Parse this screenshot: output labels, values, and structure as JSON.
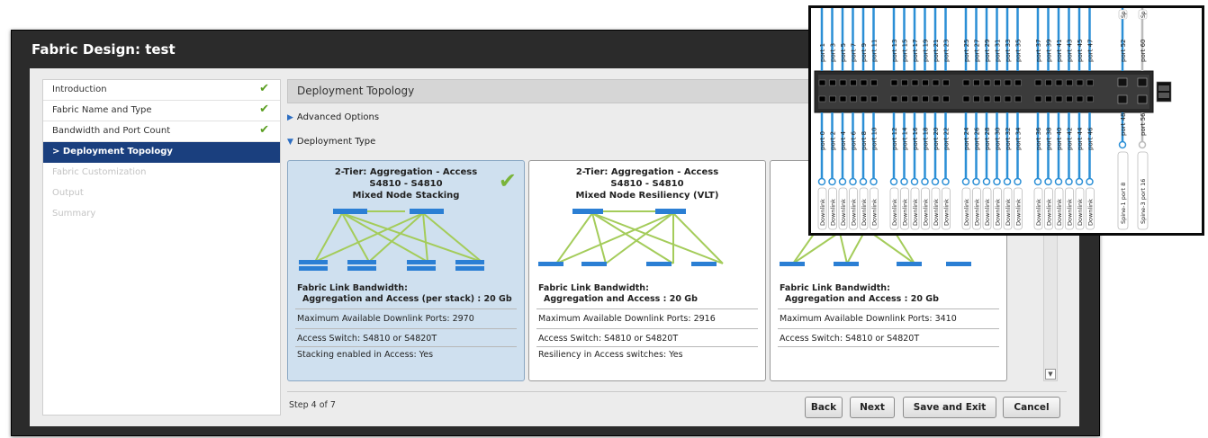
{
  "window": {
    "title": "Fabric Design: test"
  },
  "sidebar": {
    "items": [
      {
        "label": "Introduction",
        "completed": true
      },
      {
        "label": "Fabric Name and Type",
        "completed": true
      },
      {
        "label": "Bandwidth and Port Count",
        "completed": true
      },
      {
        "label": "> Deployment Topology",
        "active": true
      },
      {
        "label": "Fabric Customization",
        "disabled": true
      },
      {
        "label": "Output",
        "disabled": true
      },
      {
        "label": "Summary",
        "disabled": true
      }
    ]
  },
  "main": {
    "section_title": "Deployment Topology",
    "advanced_options": "Advanced Options",
    "deployment_type": "Deployment Type",
    "cards": [
      {
        "title1": "2-Tier: Aggregation - Access",
        "title2": "S4810 - S4810",
        "title3": "Mixed Node Stacking",
        "bw_label": "Fabric Link Bandwidth:",
        "bw_value": "Aggregation and Access (per stack) : 20 Gb",
        "ports": "Maximum Available Downlink Ports:  2970",
        "access": "Access Switch:  S4810 or S4820T",
        "extra": "Stacking enabled in Access:  Yes",
        "selected": true
      },
      {
        "title1": "2-Tier: Aggregation - Access",
        "title2": "S4810 - S4810",
        "title3": "Mixed Node Resiliency (VLT)",
        "bw_label": "Fabric Link Bandwidth:",
        "bw_value": "Aggregation and Access : 20 Gb",
        "ports": "Maximum Available Downlink Ports:  2916",
        "access": "Access Switch:  S4810 or S4820T",
        "extra": "Resiliency in Access switches:  Yes",
        "selected": false
      },
      {
        "title1": "",
        "title2": "",
        "title3": "",
        "bw_label": "Fabric Link Bandwidth:",
        "bw_value": "Aggregation and Access : 20 Gb",
        "ports": "Maximum Available Downlink Ports:  3410",
        "access": "Access Switch:  S4810 or S4820T",
        "extra": "",
        "selected": false
      }
    ],
    "step": "Step 4 of 7",
    "buttons": {
      "back": "Back",
      "next": "Next",
      "save_exit": "Save and Exit",
      "cancel": "Cancel"
    }
  },
  "overlay": {
    "top_ports": [
      "port 1",
      "port 3",
      "port 5",
      "port 7",
      "port 9",
      "port 11",
      "port 13",
      "port 15",
      "port 17",
      "port 19",
      "port 21",
      "port 23",
      "port 25",
      "port 27",
      "port 29",
      "port 31",
      "port 33",
      "port 35",
      "port 37",
      "port 39",
      "port 41",
      "port 43",
      "port 45",
      "port 47"
    ],
    "bottom_ports": [
      "port 0",
      "port 2",
      "port 4",
      "port 6",
      "port 8",
      "port 10",
      "port 12",
      "port 14",
      "port 16",
      "port 18",
      "port 20",
      "port 22",
      "port 24",
      "port 26",
      "port 28",
      "port 30",
      "port 32",
      "port 34",
      "port 36",
      "port 38",
      "port 40",
      "port 42",
      "port 44",
      "port 46"
    ],
    "uplink_top": [
      "port 52",
      "port 60"
    ],
    "uplink_bottom": [
      "port 48",
      "port 56"
    ],
    "downlink_label": "Downlink",
    "spine_labels": [
      "Spine-1 port 8",
      "Spine-3 port 16"
    ],
    "spine_top_labels": [
      "Sp",
      "Sp"
    ]
  },
  "colors": {
    "accent_active": "#1a3f7e",
    "check": "#5a9e21",
    "link": "#2b8fd6",
    "topo_line": "#a4cc5a",
    "switch": "#2b7fd4"
  }
}
